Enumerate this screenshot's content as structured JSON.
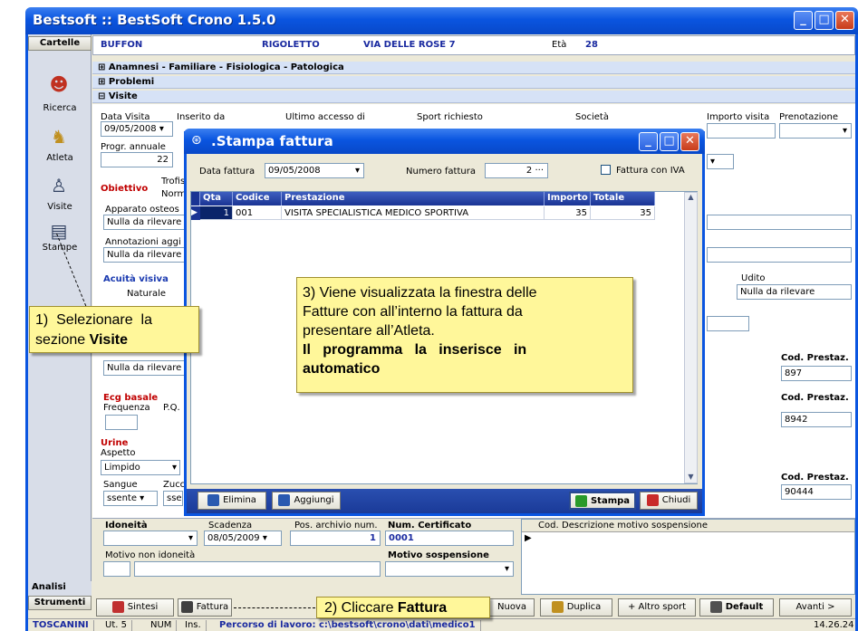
{
  "window": {
    "title": "Bestsoft :: BestSoft Crono 1.5.0"
  },
  "sidebar": {
    "header": "Cartelle",
    "items": [
      {
        "label": "Ricerca",
        "icon": "people-icon"
      },
      {
        "label": "Atleta",
        "icon": "user-icon"
      },
      {
        "label": "Visite",
        "icon": "doctor-icon"
      },
      {
        "label": "Stampe",
        "icon": "document-icon"
      }
    ],
    "analisi": "Analisi",
    "strumenti": "Strumenti"
  },
  "patient": {
    "surname": "BUFFON",
    "name": "RIGOLETTO",
    "address": "VIA DELLE ROSE 7",
    "age_label": "Età",
    "age": "28"
  },
  "sections": {
    "anamnesi": "Anamnesi - Familiare - Fisiologica - Patologica",
    "problemi": "Problemi",
    "visite": "Visite"
  },
  "visit": {
    "data_visita_label": "Data Visita",
    "data_visita": "09/05/2008",
    "inserito_da_label": "Inserito da",
    "ultimo_accesso_label": "Ultimo accesso di",
    "sport_label": "Sport richiesto",
    "societa_label": "Società",
    "importo_label": "Importo visita",
    "prenotazione_label": "Prenotazione",
    "progr_label": "Progr. annuale",
    "progr_value": "22",
    "obiettivo": "Obiettivo",
    "trofis": "Trofis",
    "norm": "Norm",
    "apparato": "Apparato osteos",
    "nulla": "Nulla da rilevare",
    "annotazioni": "Annotazioni aggi",
    "acuita": "Acuità visiva",
    "naturale": "Naturale",
    "udito": "Udito",
    "udito_value": "Nulla da rilevare",
    "cod_prestaz": "Cod. Prestaz.",
    "cod1": "897",
    "cod2": "8942",
    "cod3": "90444",
    "ecg": "Ecg basale",
    "frequenza": "Frequenza",
    "pq": "P.Q.",
    "urine": "Urine",
    "aspetto": "Aspetto",
    "limpido": "Limpido",
    "sangue": "Sangue",
    "zucc": "Zucc",
    "ssente": "ssente",
    "sser": "sser"
  },
  "idoneita": {
    "label": "Idoneità",
    "scadenza_label": "Scadenza",
    "scadenza": "08/05/2009",
    "pos_label": "Pos. archivio num.",
    "pos": "1",
    "cert_label": "Num. Certificato",
    "cert": "0001",
    "motivo_non": "Motivo non idoneità",
    "motivo_sosp": "Motivo sospensione",
    "grid_cod": "Cod.",
    "grid_desc": "Descrizione motivo sospensione"
  },
  "dialog": {
    "title": ".Stampa fattura",
    "data_label": "Data fattura",
    "data": "09/05/2008",
    "numero_label": "Numero fattura",
    "numero": "2",
    "iva_label": "Fattura con IVA",
    "columns": [
      "Qta",
      "Codice",
      "Prestazione",
      "Importo",
      "Totale"
    ],
    "row": {
      "qta": "1",
      "codice": "001",
      "prestazione": "VISITA SPECIALISTICA MEDICO SPORTIVA",
      "importo": "35",
      "totale": "35"
    },
    "elimina": "Elimina",
    "aggiungi": "Aggiungi",
    "stampa": "Stampa",
    "chiudi": "Chiudi"
  },
  "callouts": {
    "c1a": "1)  Selezionare  la",
    "c1b": "sezione ",
    "c1c": "Visite",
    "c3a": "3) Viene visualizzata la finestra delle",
    "c3b": "Fatture con all’interno la fattura da",
    "c3c": "presentare all’Atleta.",
    "c3d": "Il   programma   la   inserisce   in",
    "c3e": "automatico",
    "c2a": "2) Cliccare ",
    "c2b": "Fattura"
  },
  "toolbar": {
    "sintesi": "Sintesi",
    "fattura": "Fattura",
    "nuova": "Nuova",
    "duplica": "Duplica",
    "altro": "+ Altro sport",
    "default": "Default",
    "avanti": "Avanti >"
  },
  "status": {
    "user": "TOSCANINI",
    "ut": "Ut. 5",
    "num": "NUM",
    "ins": "Ins.",
    "percorso": "Percorso di lavoro: c:\\bestsoft\\crono\\dati\\medico1",
    "time": "14.26.24"
  }
}
